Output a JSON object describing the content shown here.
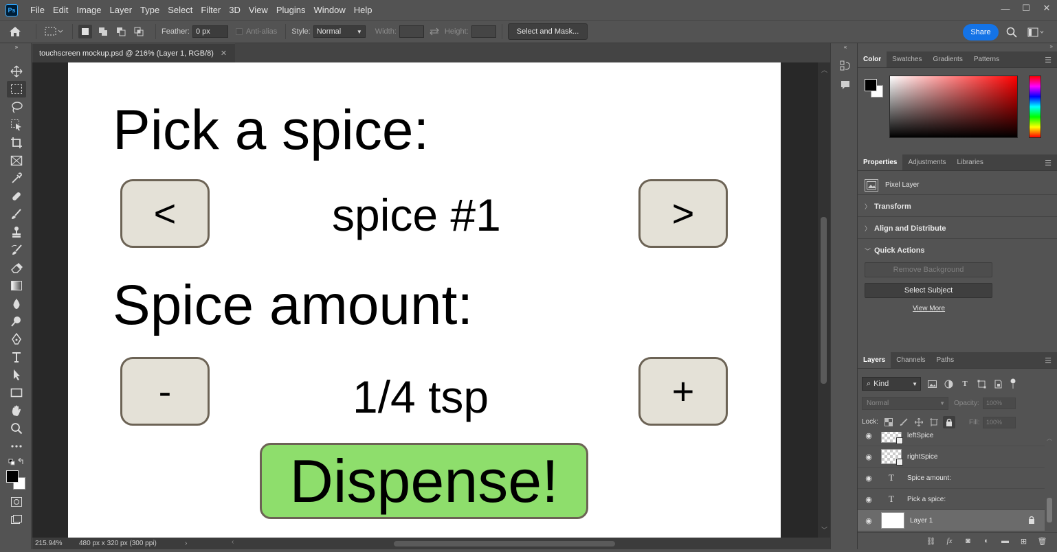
{
  "app": {
    "logo": "Ps",
    "menu": [
      "File",
      "Edit",
      "Image",
      "Layer",
      "Type",
      "Select",
      "Filter",
      "3D",
      "View",
      "Plugins",
      "Window",
      "Help"
    ],
    "window_controls": {
      "minimize": "—",
      "maximize": "☐",
      "close": "✕"
    }
  },
  "options": {
    "feather_label": "Feather:",
    "feather_value": "0 px",
    "antialias_label": "Anti-alias",
    "style_label": "Style:",
    "style_value": "Normal",
    "width_label": "Width:",
    "height_label": "Height:",
    "select_mask": "Select and Mask...",
    "share": "Share"
  },
  "document": {
    "tab_title": "touchscreen mockup.psd @ 216% (Layer 1, RGB/8)",
    "zoom": "215.94%",
    "doc_info": "480 px x 320 px (300 ppi)"
  },
  "mockup": {
    "heading_spice": "Pick a spice:",
    "prev_label": "<",
    "next_label": ">",
    "spice_value": "spice #1",
    "heading_amount": "Spice amount:",
    "minus_label": "-",
    "plus_label": "+",
    "amount_value": "1/4 tsp",
    "dispense_label": "Dispense!",
    "colors": {
      "button_fill": "#e4e1d7",
      "button_border": "#6c6355",
      "dispense_fill": "#8ede6c"
    }
  },
  "panels": {
    "color_tabs": [
      "Color",
      "Swatches",
      "Gradients",
      "Patterns"
    ],
    "properties_tabs": [
      "Properties",
      "Adjustments",
      "Libraries"
    ],
    "pixel_layer": "Pixel Layer",
    "sections": {
      "transform": "Transform",
      "align": "Align and Distribute",
      "quick_actions": "Quick Actions"
    },
    "remove_background": "Remove Background",
    "select_subject": "Select Subject",
    "view_more": "View More",
    "layers_tabs": [
      "Layers",
      "Channels",
      "Paths"
    ],
    "kind_filter": "Kind",
    "blend_mode": "Normal",
    "opacity_label": "Opacity:",
    "opacity_value": "100%",
    "lock_label": "Lock:",
    "fill_label": "Fill:",
    "fill_value": "100%",
    "layers": [
      {
        "name": "leftSpice",
        "kind": "smart"
      },
      {
        "name": "rightSpice",
        "kind": "smart"
      },
      {
        "name": "Spice amount:",
        "kind": "text"
      },
      {
        "name": "Pick a spice:",
        "kind": "text"
      },
      {
        "name": "Layer 1",
        "kind": "pixel",
        "selected": true,
        "locked": true
      }
    ]
  }
}
